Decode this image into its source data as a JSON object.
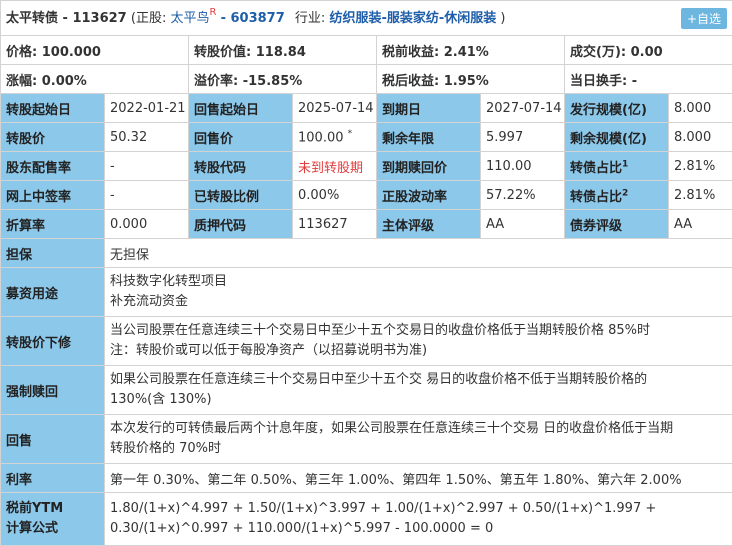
{
  "header": {
    "bond_name": "太平转债 - 113627",
    "stock_prefix": "(正股:",
    "stock_name": "太平鸟",
    "stock_badge": "R",
    "stock_code": "- 603877",
    "industry_label": "行业:",
    "industry_value": "纺织服装-服装家纺-休闲服装",
    "industry_suffix": ")",
    "add_button": "+自选"
  },
  "summary": {
    "row1": [
      {
        "label": "价格:",
        "value": "100.000"
      },
      {
        "label": "转股价值:",
        "value": "118.84"
      },
      {
        "label": "税前收益:",
        "value": "2.41%"
      },
      {
        "label": "成交(万):",
        "value": "0.00"
      }
    ],
    "row2": [
      {
        "label": "涨幅:",
        "value": "0.00%"
      },
      {
        "label": "溢价率:",
        "value": "-15.85%"
      },
      {
        "label": "税后收益:",
        "value": "1.95%"
      },
      {
        "label": "当日换手:",
        "value": "-"
      }
    ]
  },
  "grid": {
    "r1": {
      "l1": "转股起始日",
      "v1": "2022-01-21",
      "l2": "回售起始日",
      "v2": "2025-07-14",
      "l3": "到期日",
      "v3": "2027-07-14",
      "l4": "发行规模(亿)",
      "v4": "8.000"
    },
    "r2": {
      "l1": "转股价",
      "v1": "50.32",
      "l2": "回售价",
      "v2": "100.00",
      "v2_mark": "*",
      "l3": "剩余年限",
      "v3": "5.997",
      "l4": "剩余规模(亿)",
      "v4": "8.000"
    },
    "r3": {
      "l1": "股东配售率",
      "v1": "-",
      "l2": "转股代码",
      "v2": "未到转股期",
      "l3": "到期赎回价",
      "v3": "110.00",
      "l4": "转债占比",
      "l4_sup": "1",
      "v4": "2.81%"
    },
    "r4": {
      "l1": "网上中签率",
      "v1": "-",
      "l2": "已转股比例",
      "v2": "0.00%",
      "l3": "正股波动率",
      "v3": "57.22%",
      "l4": "转债占比",
      "l4_sup": "2",
      "v4": "2.81%"
    },
    "r5": {
      "l1": "折算率",
      "v1": "0.000",
      "l2": "质押代码",
      "v2": "113627",
      "l3": "主体评级",
      "v3": "AA",
      "l4": "债券评级",
      "v4": "AA"
    }
  },
  "details": {
    "guarantee": {
      "label": "担保",
      "lines": [
        "无担保"
      ]
    },
    "purpose": {
      "label": "募资用途",
      "lines": [
        "科技数字化转型项目",
        "补充流动资金"
      ]
    },
    "reset": {
      "label": "转股价下修",
      "lines": [
        "当公司股票在任意连续三十个交易日中至少十五个交易日的收盘价格低于当期转股价格 85%时",
        "注：转股价或可以低于每股净资产（以招募说明书为准)"
      ]
    },
    "redeem": {
      "label": "强制赎回",
      "lines": [
        "如果公司股票在任意连续三十个交易日中至少十五个交 易日的收盘价格不低于当期转股价格的",
        "130%(含 130%)"
      ]
    },
    "putback": {
      "label": "回售",
      "lines": [
        "本次发行的可转债最后两个计息年度，如果公司股票在任意连续三十个交易 日的收盘价格低于当期",
        "转股价格的 70%时"
      ]
    },
    "rate": {
      "label": "利率",
      "lines": [
        "第一年 0.30%、第二年 0.50%、第三年 1.00%、第四年 1.50%、第五年 1.80%、第六年 2.00%"
      ]
    },
    "ytm": {
      "label_1": "税前YTM",
      "label_2": "计算公式",
      "lines": [
        "1.80/(1+x)^4.997 + 1.50/(1+x)^3.997 + 1.00/(1+x)^2.997 + 0.50/(1+x)^1.997 +",
        "0.30/(1+x)^0.997 + 110.000/(1+x)^5.997 - 100.0000 = 0"
      ]
    }
  }
}
